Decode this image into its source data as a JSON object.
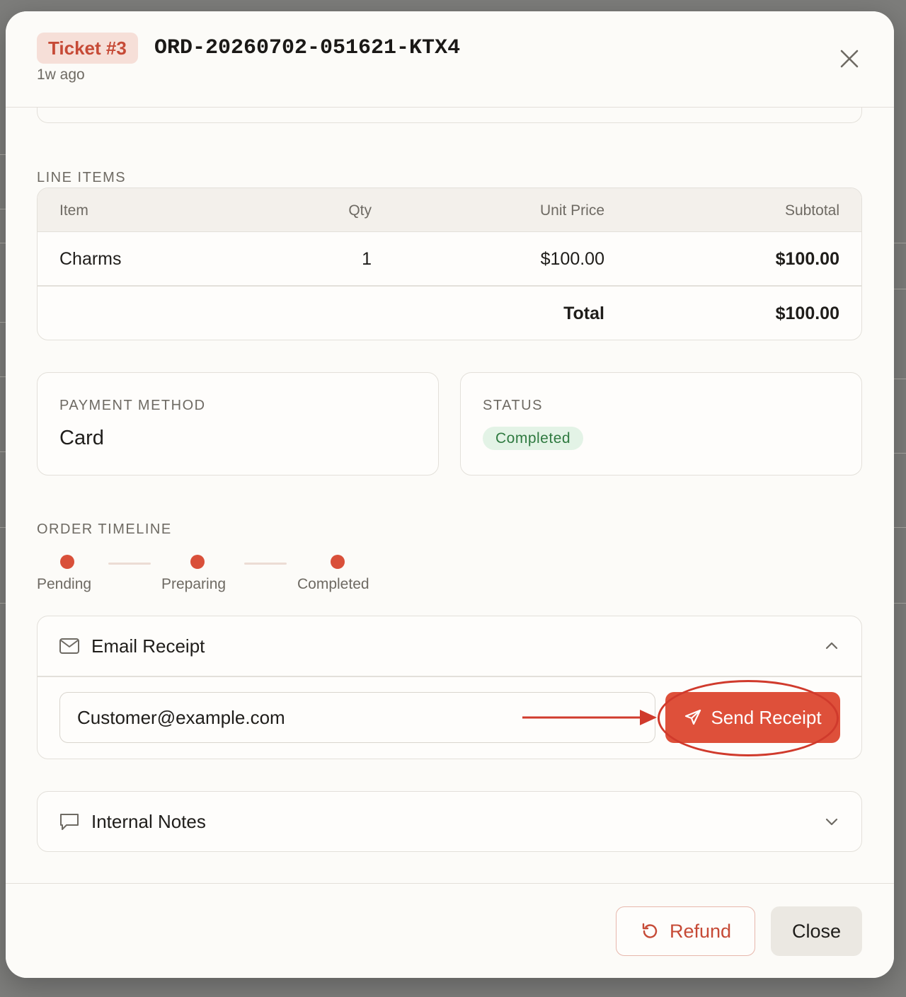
{
  "header": {
    "ticket_badge": "Ticket #3",
    "order_id": "ORD-20260702-051621-KTX4",
    "time_ago": "1w ago"
  },
  "line_items": {
    "section_label": "LINE ITEMS",
    "columns": [
      "Item",
      "Qty",
      "Unit Price",
      "Subtotal"
    ],
    "rows": [
      {
        "item": "Charms",
        "qty": "1",
        "unit_price": "$100.00",
        "subtotal": "$100.00"
      }
    ],
    "total_label": "Total",
    "total_value": "$100.00"
  },
  "payment": {
    "label": "PAYMENT METHOD",
    "value": "Card"
  },
  "status": {
    "label": "STATUS",
    "value": "Completed",
    "color": "#2f7a40"
  },
  "timeline": {
    "section_label": "ORDER TIMELINE",
    "steps": [
      "Pending",
      "Preparing",
      "Completed"
    ],
    "accent": "#d9503a"
  },
  "email_receipt": {
    "title": "Email Receipt",
    "icon": "mail-icon",
    "expanded": true,
    "email_value": "Customer@example.com",
    "send_label": "Send Receipt"
  },
  "internal_notes": {
    "title": "Internal Notes",
    "icon": "message-square-icon",
    "expanded": false
  },
  "footer": {
    "refund_label": "Refund",
    "close_label": "Close"
  },
  "colors": {
    "accent": "#de503a",
    "annotation": "#d03a2c"
  }
}
